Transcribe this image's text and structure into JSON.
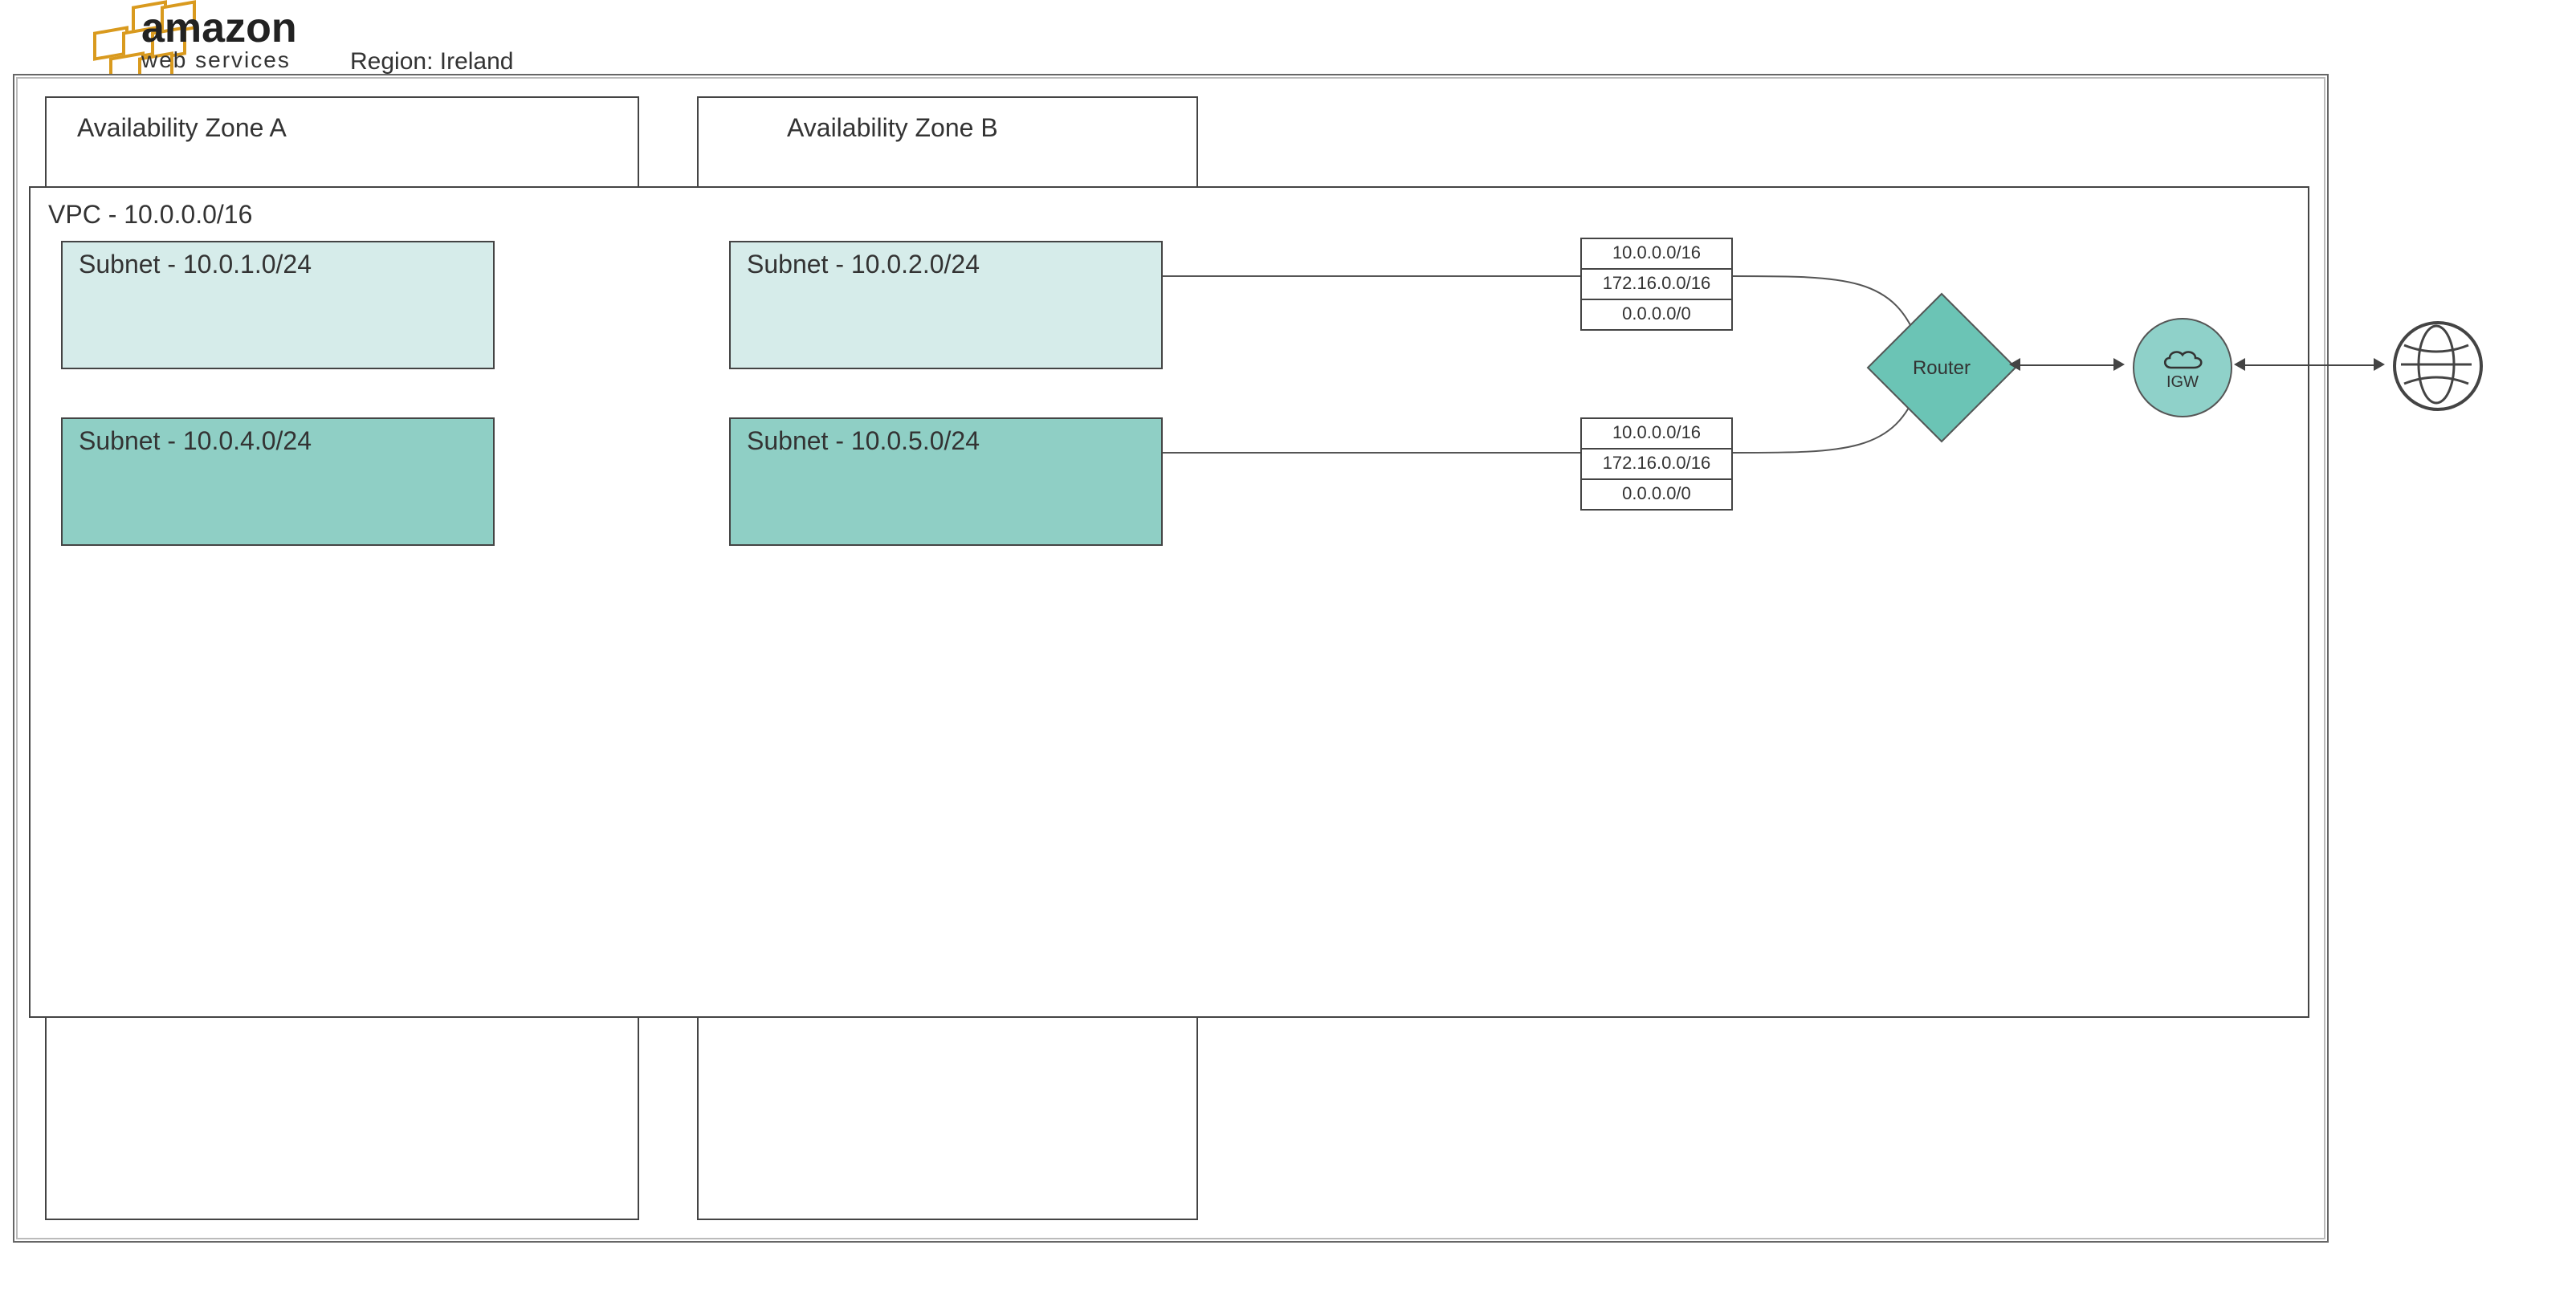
{
  "brand": {
    "line1": "amazon",
    "line2": "web services"
  },
  "region_label_prefix": "Region: ",
  "region_name": "Ireland",
  "az_a_label": "Availability Zone A",
  "az_b_label": "Availability Zone B",
  "vpc_label": "VPC - 10.0.0.0/16",
  "subnets": {
    "a1": "Subnet - 10.0.1.0/24",
    "a2": "Subnet - 10.0.4.0/24",
    "b1": "Subnet - 10.0.2.0/24",
    "b2": "Subnet - 10.0.5.0/24"
  },
  "route_table_top": {
    "r1": "10.0.0.0/16",
    "r2": "172.16.0.0/16",
    "r3": "0.0.0.0/0"
  },
  "route_table_bottom": {
    "r1": "10.0.0.0/16",
    "r2": "172.16.0.0/16",
    "r3": "0.0.0.0/0"
  },
  "router_label": "Router",
  "igw_label": "IGW",
  "colors": {
    "subnet_public": "#d6ecea",
    "subnet_private": "#8fcfc5",
    "router_fill": "#6bc4b5",
    "igw_fill": "#8fd1c9",
    "aws_orange": "#d99a1e"
  }
}
